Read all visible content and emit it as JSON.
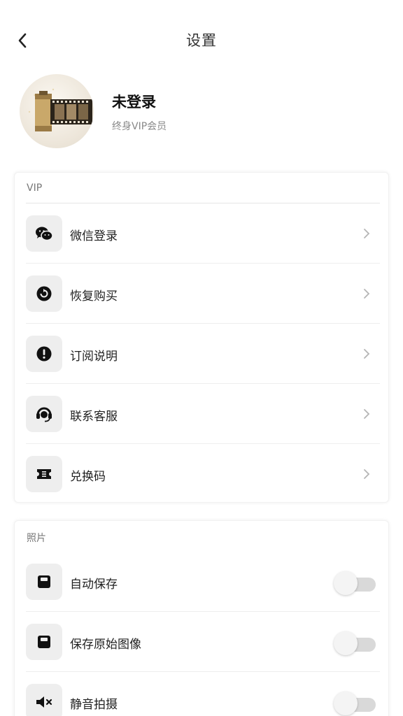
{
  "header": {
    "title": "设置"
  },
  "profile": {
    "name": "未登录",
    "membership": "终身VIP会员"
  },
  "vip_section": {
    "label": "VIP",
    "items": [
      {
        "label": "微信登录",
        "icon": "wechat-icon"
      },
      {
        "label": "恢复购买",
        "icon": "restore-icon"
      },
      {
        "label": "订阅说明",
        "icon": "info-icon"
      },
      {
        "label": "联系客服",
        "icon": "headset-icon"
      },
      {
        "label": "兑换码",
        "icon": "ticket-icon"
      }
    ]
  },
  "photo_section": {
    "label": "照片",
    "items": [
      {
        "label": "自动保存",
        "icon": "save-icon",
        "enabled": false
      },
      {
        "label": "保存原始图像",
        "icon": "save-icon",
        "enabled": false
      },
      {
        "label": "静音拍摄",
        "icon": "mute-icon",
        "enabled": false
      }
    ]
  },
  "colors": {
    "icon": "#111111",
    "icon_bg": "#eeeeee",
    "toggle_off": "#d9d9d9"
  }
}
